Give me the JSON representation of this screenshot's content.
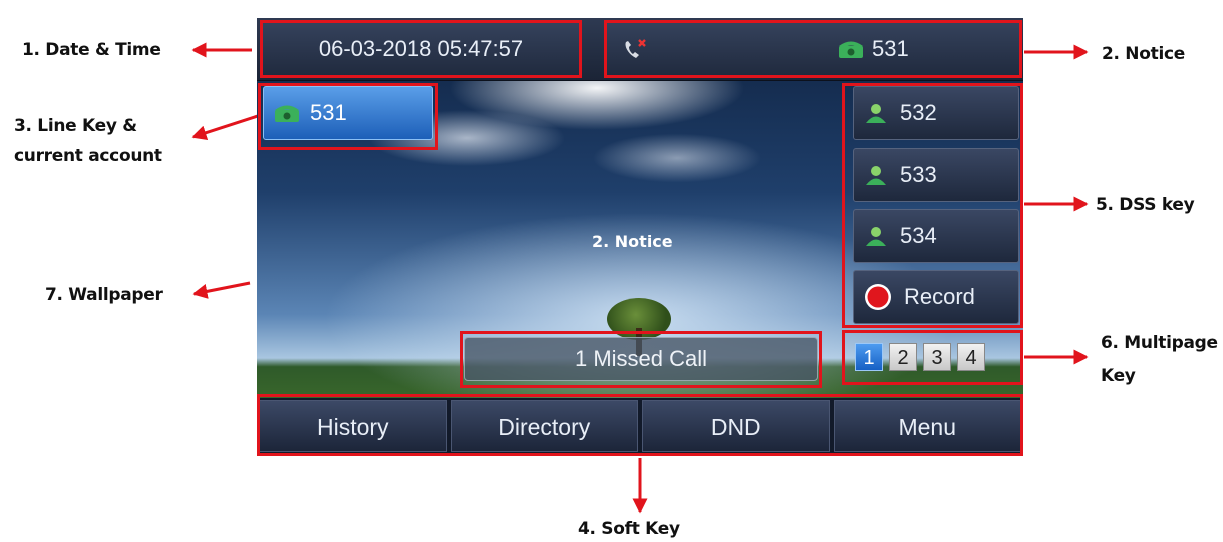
{
  "callouts": {
    "date_time": "1. Date & Time",
    "notice": "2. Notice",
    "line_key": "3. Line Key &",
    "line_key_2": "current account",
    "soft_key": "4. Soft Key",
    "dss_key": "5. DSS key",
    "multipage": "6. Multipage",
    "multipage_2": "Key",
    "wallpaper": "7. Wallpaper",
    "overlay_notice": "2. Notice"
  },
  "screen": {
    "datetime": "06-03-2018 05:47:57",
    "notice_account": "531",
    "line_key": {
      "label": "531",
      "icon": "phone-icon"
    },
    "dss_keys": [
      {
        "label": "532",
        "icon": "contact-icon"
      },
      {
        "label": "533",
        "icon": "contact-icon"
      },
      {
        "label": "534",
        "icon": "contact-icon"
      },
      {
        "label": "Record",
        "icon": "record-icon"
      }
    ],
    "pages": [
      "1",
      "2",
      "3",
      "4"
    ],
    "active_page": "1",
    "missed_call": "1 Missed Call",
    "softkeys": [
      "History",
      "Directory",
      "DND",
      "Menu"
    ]
  },
  "colors": {
    "highlight": "#e1141c",
    "linekey_active": "#2f7ad6",
    "phone_icon": "#3bb05a"
  }
}
